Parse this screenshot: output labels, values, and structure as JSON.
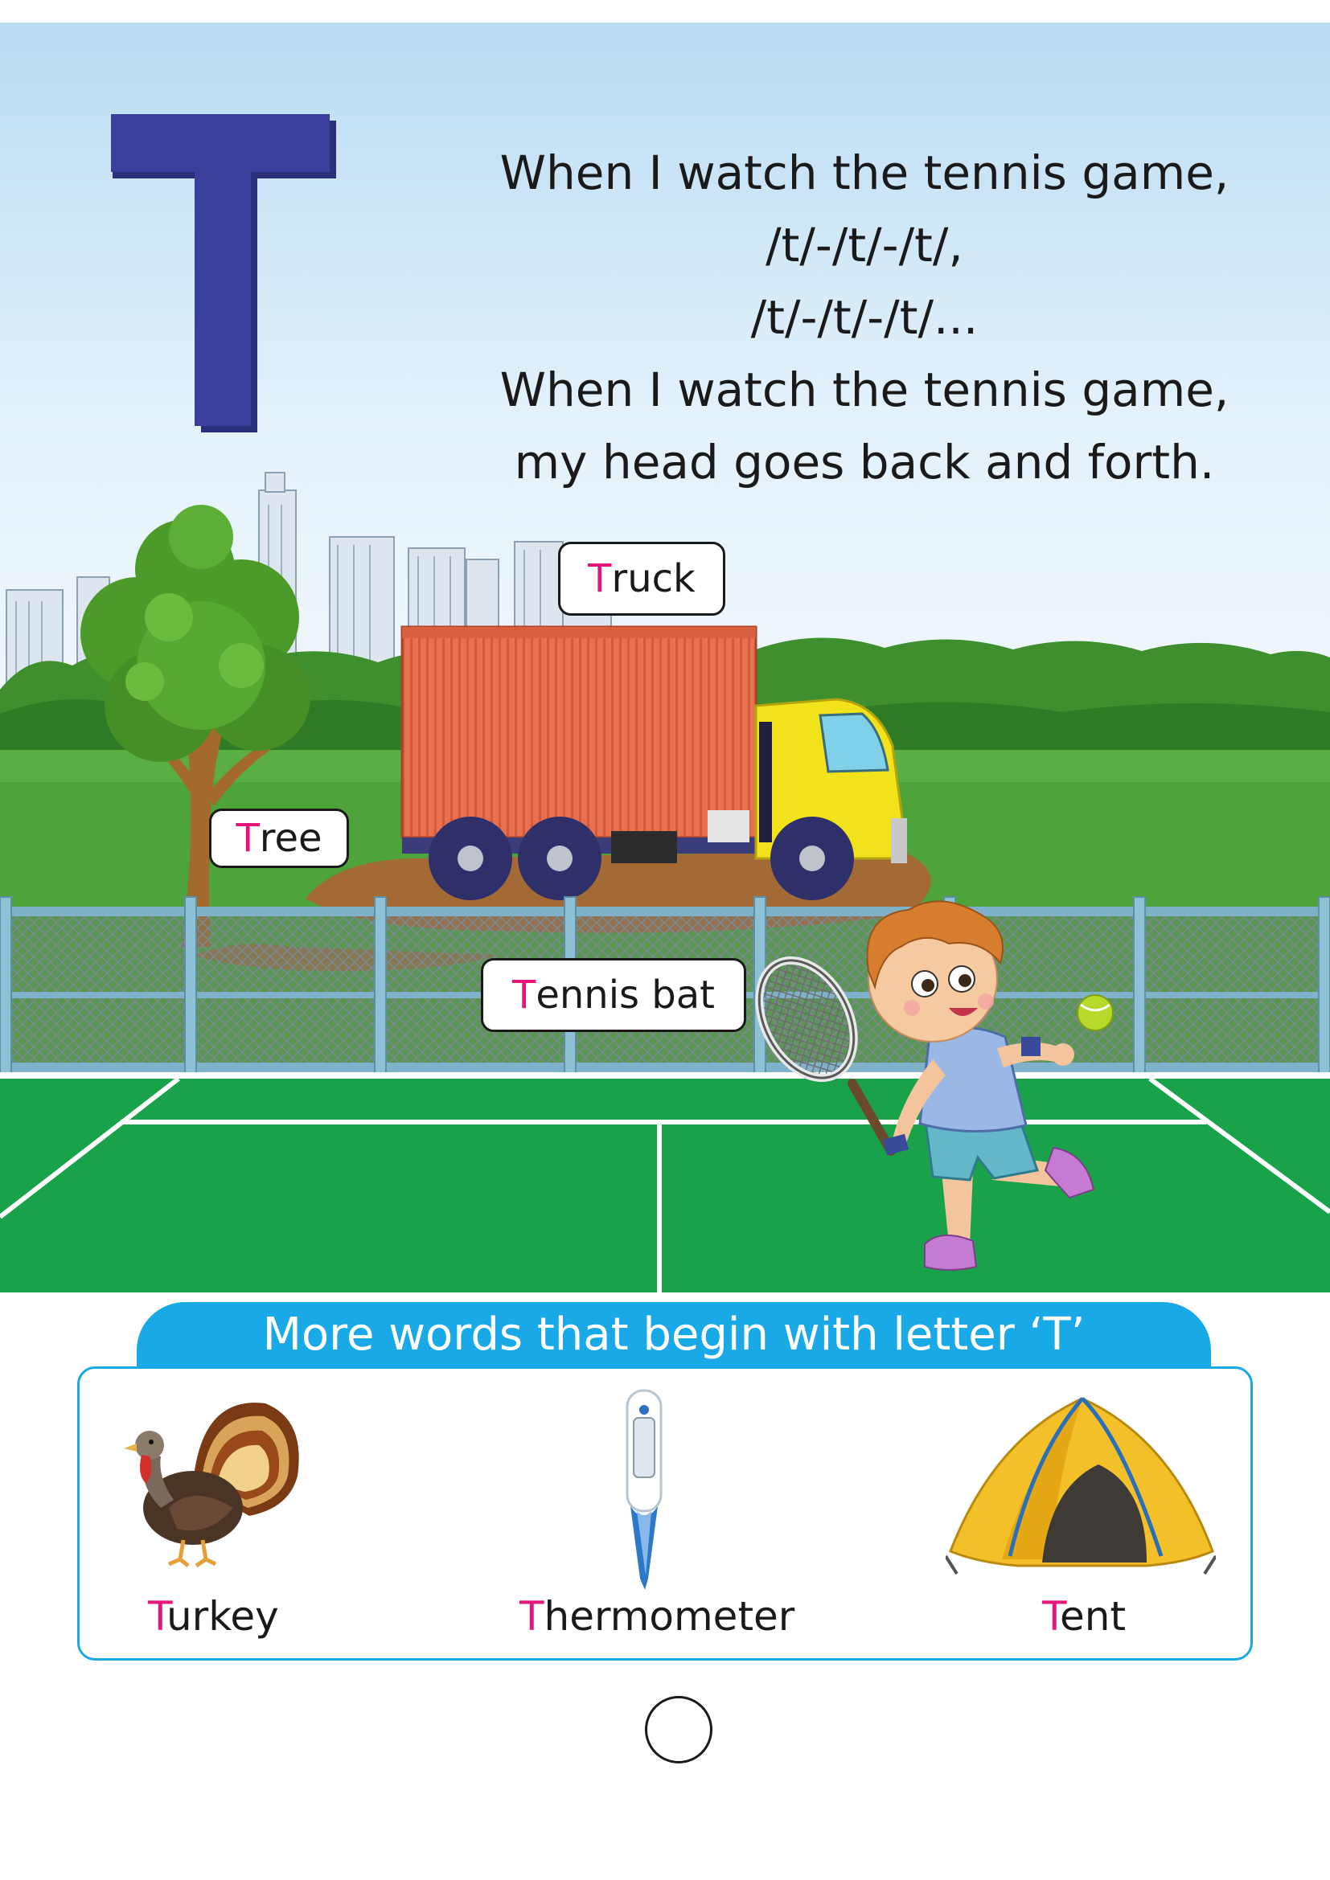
{
  "letter": "T",
  "poem": {
    "lines": [
      "When I watch the tennis game,",
      "/t/-/t/-/t/,",
      "/t/-/t/-/t/...",
      "When I watch the tennis game,",
      "my head goes back and forth."
    ]
  },
  "scene_labels": {
    "truck": {
      "first": "T",
      "rest": "ruck"
    },
    "tree": {
      "first": "T",
      "rest": "ree"
    },
    "tennis_bat": {
      "first": "T",
      "rest": "ennis bat"
    }
  },
  "more_words": {
    "heading": "More words that begin with letter ‘T’",
    "items": [
      {
        "first": "T",
        "rest": "urkey",
        "icon": "turkey-icon"
      },
      {
        "first": "T",
        "rest": "hermometer",
        "icon": "thermometer-icon"
      },
      {
        "first": "T",
        "rest": "ent",
        "icon": "tent-icon"
      }
    ]
  },
  "colors": {
    "letter": "#3a3f9c",
    "highlight": "#e5157a",
    "banner": "#19a9e6",
    "court": "#1aa24a",
    "sky": "#cfe8f7"
  }
}
